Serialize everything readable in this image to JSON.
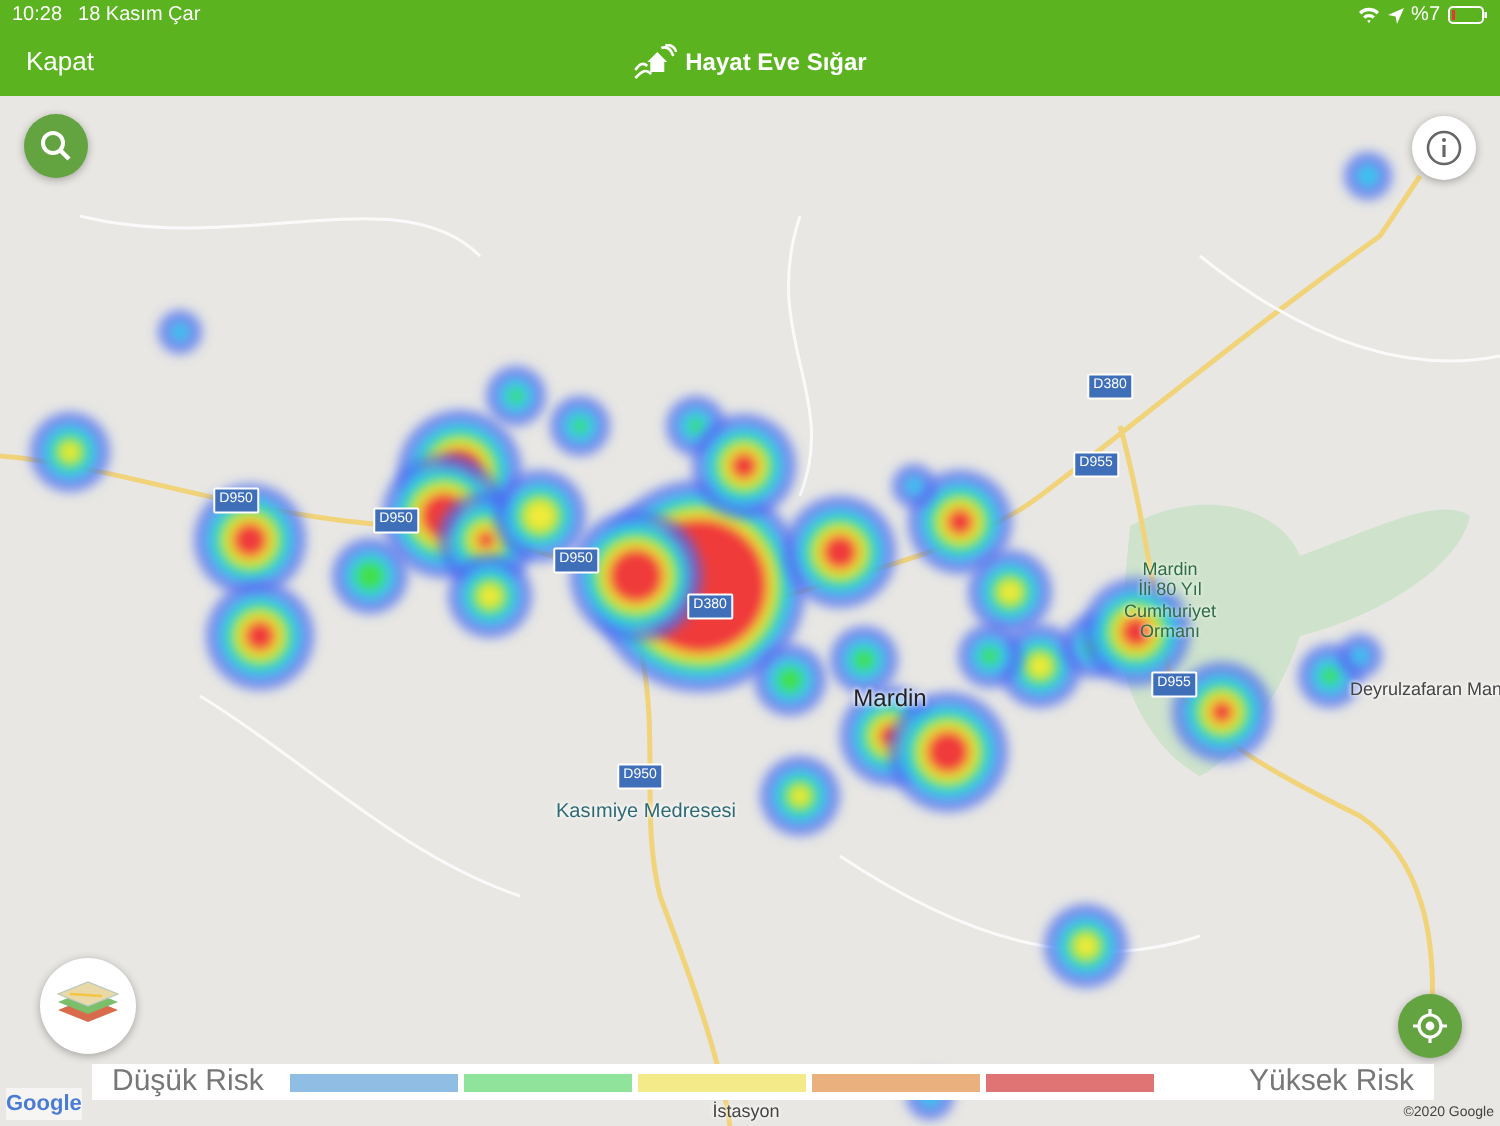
{
  "status_bar": {
    "time": "10:28",
    "date": "18 Kasım Çar",
    "battery": "%7"
  },
  "header": {
    "close": "Kapat",
    "title": "Hayat Eve Sığar"
  },
  "map": {
    "labels": [
      {
        "kind": "road",
        "text": "D950"
      },
      {
        "kind": "road",
        "text": "D950"
      },
      {
        "kind": "road",
        "text": "D950"
      },
      {
        "kind": "road",
        "text": "D380"
      },
      {
        "kind": "road",
        "text": "D380"
      },
      {
        "kind": "road",
        "text": "D955"
      },
      {
        "kind": "road",
        "text": "D955"
      },
      {
        "kind": "road",
        "text": "D950"
      },
      {
        "kind": "city",
        "text": "Mardin"
      },
      {
        "kind": "park",
        "text": "Mardin\nİli 80 Yıl\nCumhuriyet\nOrmanı"
      },
      {
        "kind": "place",
        "text": "Deyrulzafaran Man"
      },
      {
        "kind": "poi",
        "text": "Kasımiye Medresesi"
      },
      {
        "kind": "place",
        "text": "İstasyon"
      }
    ],
    "google_logo": "Google",
    "copyright": "©2020 Google"
  },
  "legend": {
    "low": "Düşük Risk",
    "high": "Yüksek Risk",
    "levels": [
      {
        "color": "#8fbde3"
      },
      {
        "color": "#90e39a"
      },
      {
        "color": "#f5ea8a"
      },
      {
        "color": "#eab07e"
      },
      {
        "color": "#e07474"
      }
    ]
  }
}
